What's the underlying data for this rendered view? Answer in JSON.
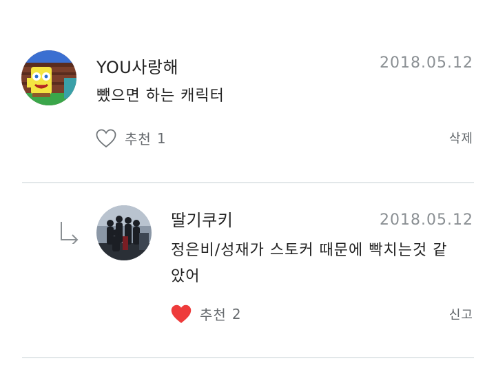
{
  "comments": [
    {
      "author": "YOU사랑해",
      "date": "2018.05.12",
      "text": "뺐으면 하는 캐릭터",
      "like_label": "추천",
      "like_count": "1",
      "liked": false,
      "action_label": "삭제",
      "avatar_icon": "spongebob-avatar"
    },
    {
      "author": "딸기쿠키",
      "date": "2018.05.12",
      "text": "정은비/성재가 스토커 때문에 빡치는것 같았어",
      "like_label": "추천",
      "like_count": "2",
      "liked": true,
      "action_label": "신고",
      "avatar_icon": "group-photo-avatar",
      "is_reply": true
    }
  ],
  "icons": {
    "reply_arrow": "reply-arrow-icon",
    "heart_outline": "heart-outline-icon",
    "heart_filled": "heart-filled-icon"
  },
  "colors": {
    "heart_filled": "#ee3b3b",
    "divider": "#e2e7e9",
    "date": "#8a8f93"
  }
}
